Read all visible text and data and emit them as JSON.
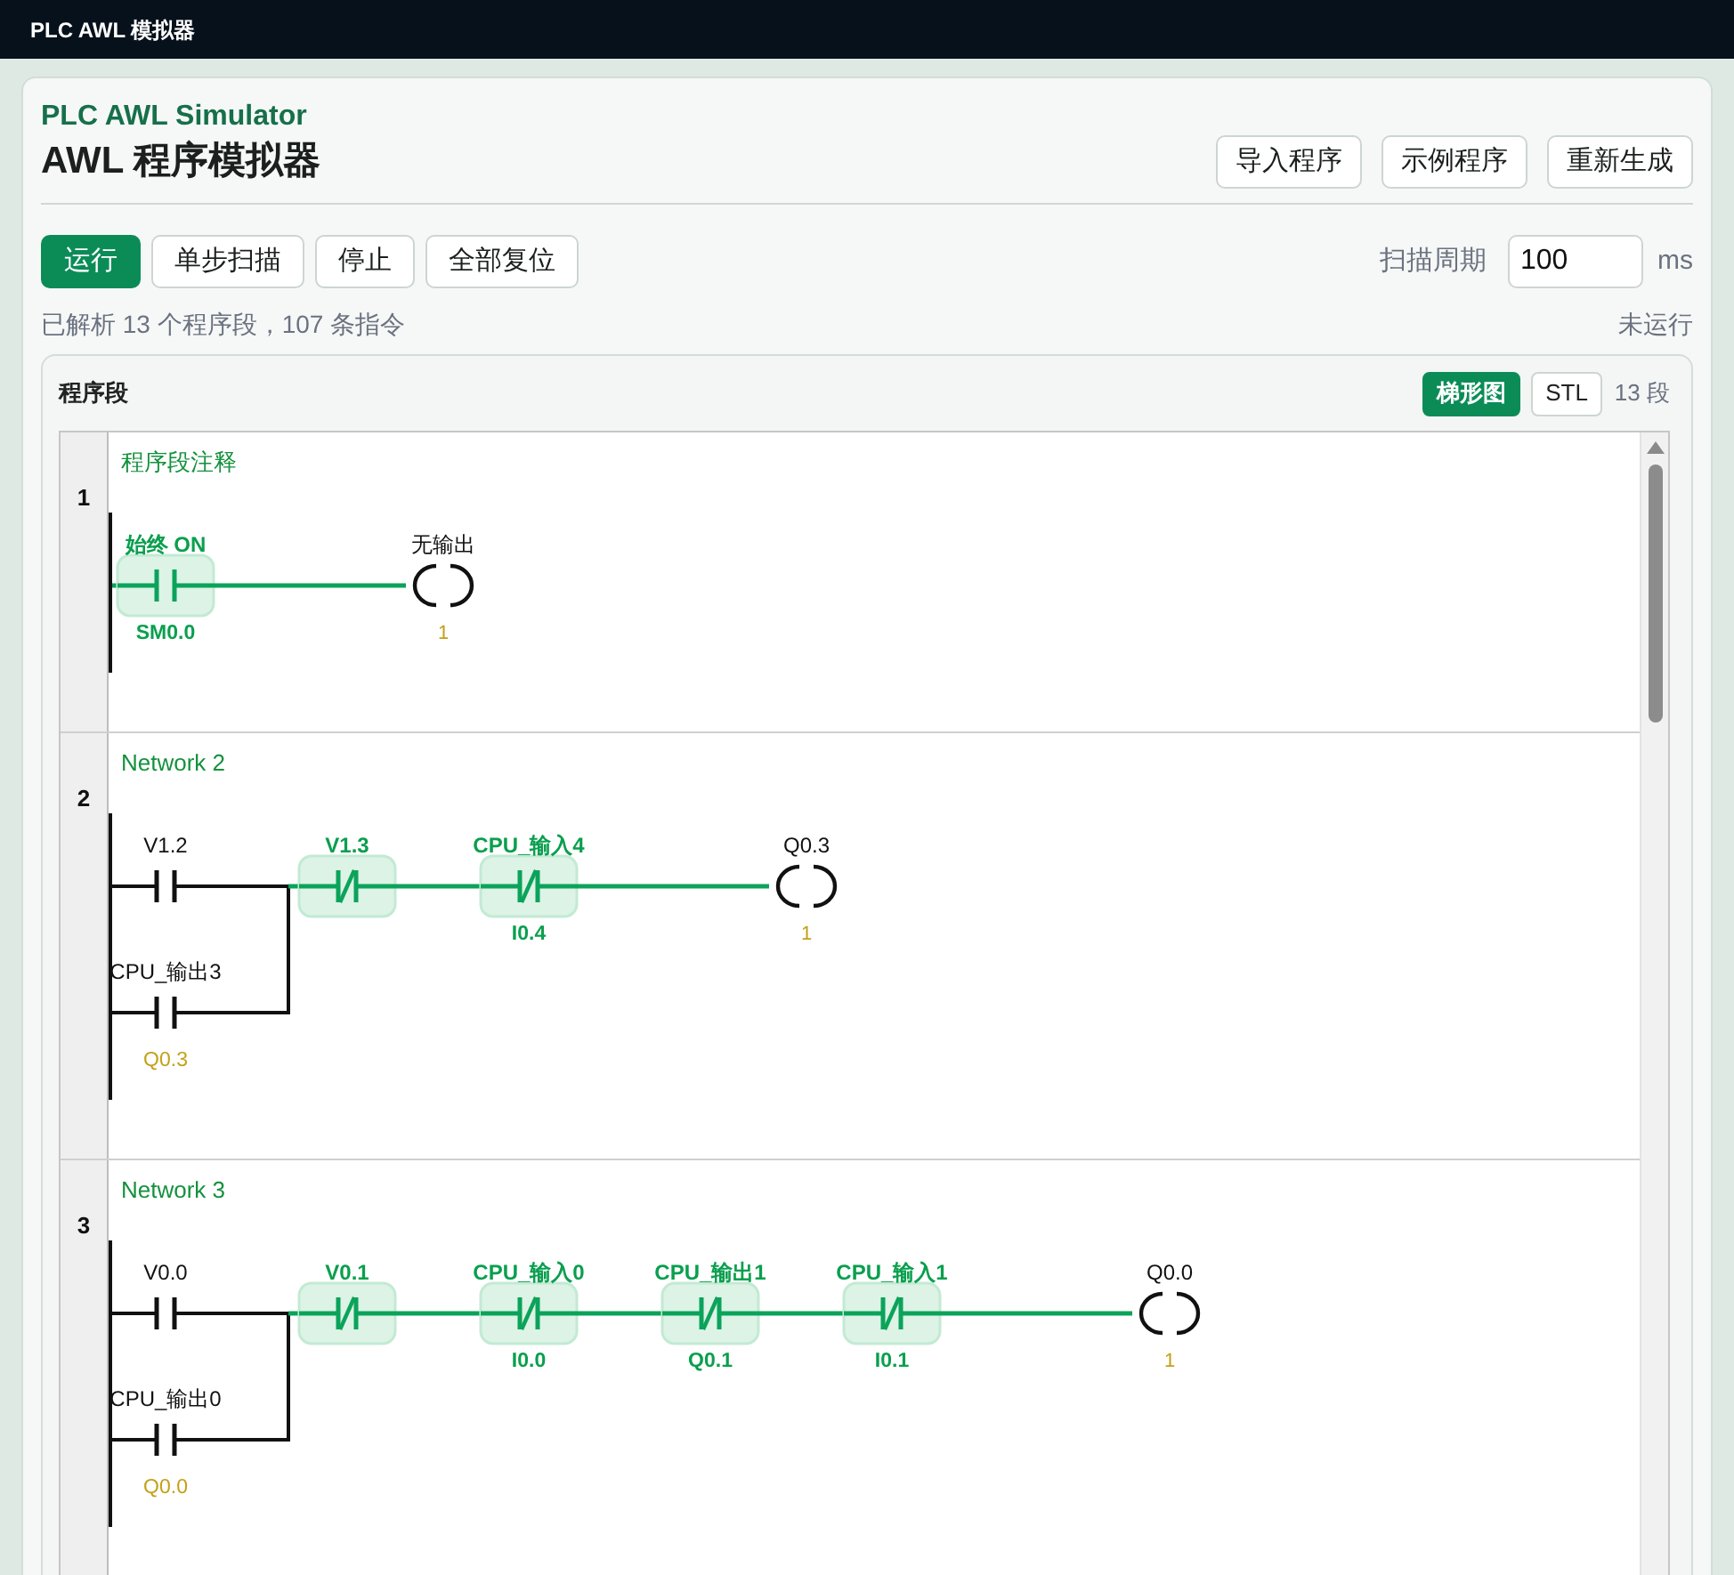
{
  "app_bar": {
    "title": "PLC AWL 模拟器"
  },
  "header": {
    "subtitle": "PLC AWL Simulator",
    "title": "AWL 程序模拟器",
    "actions": [
      "导入程序",
      "示例程序",
      "重新生成"
    ]
  },
  "toolbar": {
    "buttons": [
      {
        "label": "运行",
        "kind": "primary"
      },
      {
        "label": "单步扫描",
        "kind": "default"
      },
      {
        "label": "停止",
        "kind": "default"
      },
      {
        "label": "全部复位",
        "kind": "default"
      }
    ],
    "scan_period": {
      "label": "扫描周期",
      "value": "100",
      "unit": "ms"
    }
  },
  "status": {
    "summary": "已解析 13 个程序段，107 条指令",
    "state": "未运行"
  },
  "program_panel": {
    "title": "程序段",
    "views": [
      {
        "label": "梯形图",
        "selected": true
      },
      {
        "label": "STL",
        "selected": false
      }
    ],
    "count": "13 段",
    "networks": [
      {
        "number": "1",
        "comment": "程序段注释",
        "columns": [
          {
            "kind": "contact",
            "label": "始终 ON",
            "address": "SM0.0",
            "normally_closed": false,
            "energized": true
          }
        ],
        "coil": {
          "label": "无输出",
          "value": "1"
        }
      },
      {
        "number": "2",
        "comment": "Network 2",
        "columns": [
          {
            "kind": "parallel",
            "branches": [
              {
                "label": "V1.2",
                "normally_closed": false,
                "energized": false
              },
              {
                "label": "CPU_输出3",
                "address": "Q0.3",
                "normally_closed": false,
                "energized": false
              }
            ]
          },
          {
            "kind": "contact",
            "label": "V1.3",
            "normally_closed": true,
            "energized": true
          },
          {
            "kind": "contact",
            "label": "CPU_输入4",
            "address": "I0.4",
            "normally_closed": true,
            "energized": true
          }
        ],
        "coil": {
          "label": "Q0.3",
          "value": "1"
        }
      },
      {
        "number": "3",
        "comment": "Network 3",
        "columns": [
          {
            "kind": "parallel",
            "branches": [
              {
                "label": "V0.0",
                "normally_closed": false,
                "energized": false
              },
              {
                "label": "CPU_输出0",
                "address": "Q0.0",
                "normally_closed": false,
                "energized": false
              }
            ]
          },
          {
            "kind": "contact",
            "label": "V0.1",
            "normally_closed": true,
            "energized": true
          },
          {
            "kind": "contact",
            "label": "CPU_输入0",
            "address": "I0.0",
            "normally_closed": true,
            "energized": true
          },
          {
            "kind": "contact",
            "label": "CPU_输出1",
            "address": "Q0.1",
            "normally_closed": true,
            "energized": true
          },
          {
            "kind": "contact",
            "label": "CPU_输入1",
            "address": "I0.1",
            "normally_closed": true,
            "energized": true
          }
        ],
        "coil": {
          "label": "Q0.0",
          "value": "1"
        }
      }
    ]
  }
}
